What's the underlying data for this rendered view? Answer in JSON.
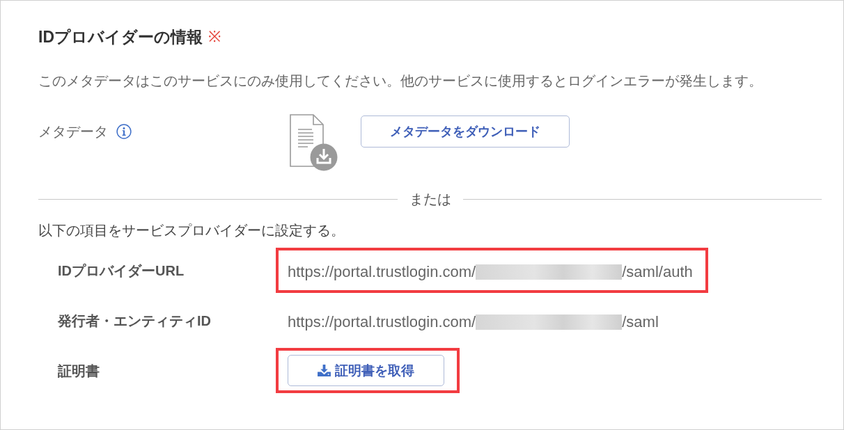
{
  "section": {
    "title": "IDプロバイダーの情報",
    "required_mark": "※",
    "description": "このメタデータはこのサービスにのみ使用してください。他のサービスに使用するとログインエラーが発生します。",
    "metadata": {
      "label": "メタデータ",
      "download_button": "メタデータをダウンロード"
    },
    "divider": "または",
    "instruction": "以下の項目をサービスプロバイダーに設定する。",
    "fields": [
      {
        "kind": "url",
        "label": "IDプロバイダーURL",
        "value_start": "https://portal.trustlogin.com/",
        "redacted": true,
        "value_end": "/saml/auth",
        "highlighted": true
      },
      {
        "kind": "url",
        "label": "発行者・エンティティID",
        "value_start": "https://portal.trustlogin.com/",
        "redacted": true,
        "value_end": "/saml",
        "highlighted": false
      },
      {
        "kind": "button",
        "label": "証明書",
        "button": "証明書を取得",
        "highlighted": true
      }
    ]
  }
}
